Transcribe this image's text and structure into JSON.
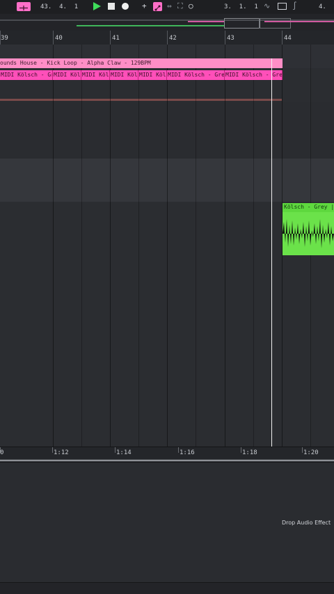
{
  "transport": {
    "arrangement_position": "43.  4.  1",
    "loop_start": "3.  1.  1",
    "loop_length": "4.",
    "icons": [
      "midi-map-icon",
      "play-icon",
      "stop-icon",
      "record-icon",
      "add-icon",
      "automation-arm-icon",
      "loop-icon",
      "punch-icon",
      "metronome-icon",
      "follow-icon",
      "draw-mode-icon",
      "curve-icon"
    ]
  },
  "ruler": {
    "bars": [
      "39",
      "40",
      "41",
      "42",
      "43",
      "44"
    ]
  },
  "clips": {
    "audio_clip": "ounds House - Kick Loop - Alpha Claw - 129BPM",
    "midi_clips": [
      "MIDI Kölsch - Grey",
      "MIDI Kölsch",
      "MIDI Kölsch",
      "MIDI Kölsch",
      "MIDI Kölsch - Grey",
      "MIDI Kölsch - Grey"
    ],
    "green_clip": "Kölsch - Grey |wav"
  },
  "time_ruler": {
    "labels": [
      "0",
      "1:12",
      "1:14",
      "1:16",
      "1:18",
      "1:20"
    ]
  },
  "device_panel": {
    "drop_text": "Drop Audio Effect"
  },
  "colors": {
    "audio_clip": "#ff8ec6",
    "midi_clip": "#ff4fb9",
    "green_clip": "#6be24a",
    "play": "#3fdc5a",
    "playhead": "#f2f2f2"
  }
}
